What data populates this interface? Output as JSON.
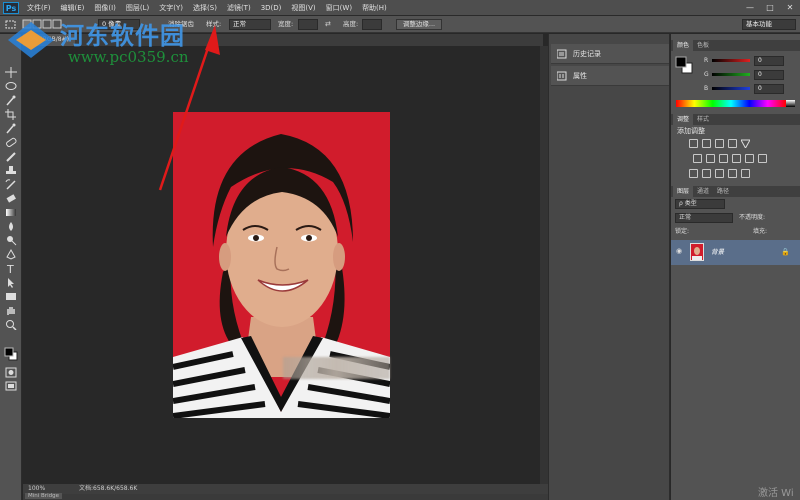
{
  "app": {
    "logo": "Ps"
  },
  "menu": [
    "文件(F)",
    "编辑(E)",
    "图像(I)",
    "图层(L)",
    "文字(Y)",
    "选择(S)",
    "滤镜(T)",
    "3D(D)",
    "视图(V)",
    "窗口(W)",
    "帮助(H)"
  ],
  "window_controls": {
    "minimize": "—",
    "maximize": "□",
    "close": "✕"
  },
  "options": {
    "feather_value": "0 像素",
    "anti_alias": "消除锯齿",
    "style_label": "样式:",
    "style_value": "正常",
    "width_label": "宽度:",
    "height_label": "高度:",
    "refine_edge": "调整边缘...",
    "workspace": "基本功能"
  },
  "document": {
    "tab_label": "0% (RGB/8#)",
    "zoom": "100%",
    "doc_info": "文档:658.6K/658.6K",
    "bottom_tab": "Mini Bridge"
  },
  "mid_panel": [
    {
      "label": "历史记录",
      "icon": "history-icon"
    },
    {
      "label": "属性",
      "icon": "properties-icon"
    }
  ],
  "color_panel": {
    "tabs": [
      "颜色",
      "色板"
    ],
    "channels": [
      {
        "name": "R",
        "value": "0",
        "color": "#e02020"
      },
      {
        "name": "G",
        "value": "0",
        "color": "#20b020"
      },
      {
        "name": "B",
        "value": "0",
        "color": "#2040e0"
      }
    ]
  },
  "adjust_panel": {
    "tabs": [
      "调整",
      "样式"
    ],
    "heading": "添加调整"
  },
  "layers_panel": {
    "tabs": [
      "图层",
      "通道",
      "路径"
    ],
    "filter_kind": "ρ 类型",
    "blend_mode": "正常",
    "opacity_label": "不透明度:",
    "lock_label": "锁定:",
    "fill_label": "填充:",
    "layer_name": "背景"
  },
  "watermark": {
    "site_name": "河东软件园",
    "url": "www.pc0359.cn"
  },
  "activate_text": "激活 Wi",
  "colors": {
    "photo_background": "#d11c2c",
    "selected_layer": "#5a6e8a"
  }
}
